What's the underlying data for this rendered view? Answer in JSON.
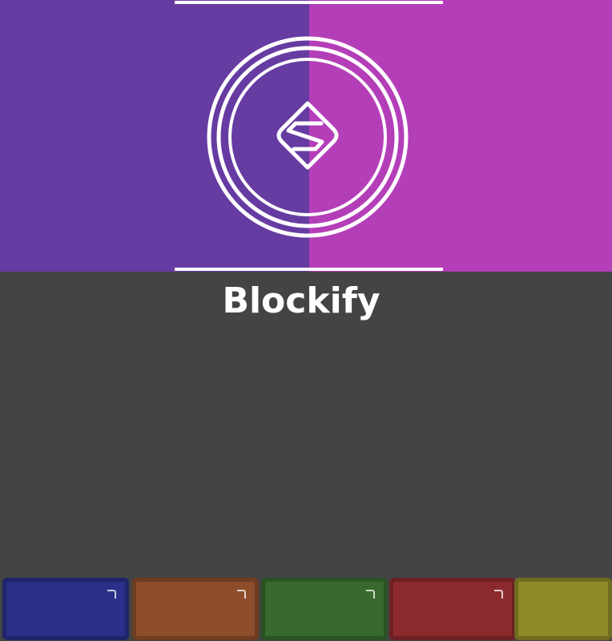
{
  "app": {
    "title": "Blockify"
  },
  "colors": {
    "background": "#444444",
    "hero_left": "#663ba2",
    "hero_right": "#b43eb8",
    "title_text": "#ffffff"
  },
  "hero": {
    "logo_icon": "s-diamond-coin-icon"
  },
  "blocks": [
    {
      "color_name": "blue",
      "color": "#2a2f88"
    },
    {
      "color_name": "orange",
      "color": "#8d4d2b"
    },
    {
      "color_name": "green",
      "color": "#376a2c"
    },
    {
      "color_name": "red",
      "color": "#8b2a2d"
    },
    {
      "color_name": "yellow",
      "color": "#8f8a2a"
    }
  ]
}
